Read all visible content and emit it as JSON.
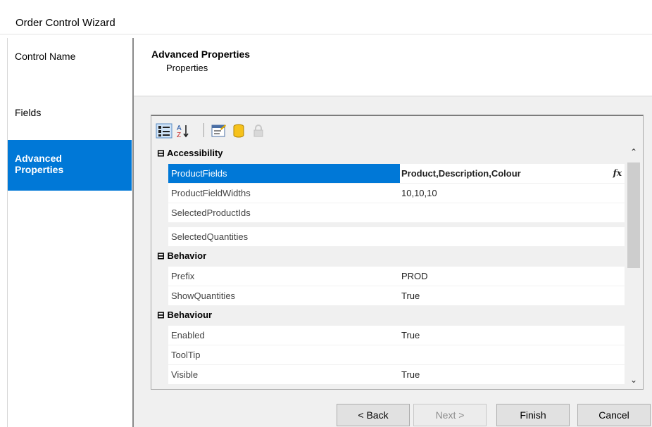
{
  "window": {
    "title": "Order Control Wizard"
  },
  "nav": {
    "items": [
      {
        "label": "Control Name"
      },
      {
        "label": "Fields"
      },
      {
        "label_line1": "Advanced",
        "label_line2": "Properties",
        "active": true
      }
    ]
  },
  "header": {
    "title": "Advanced Properties",
    "subtitle": "Properties"
  },
  "grid": {
    "toolbar_icons": [
      "categorized-icon",
      "alphabetical-icon",
      "property-pages-icon",
      "database-icon",
      "lock-icon"
    ],
    "categories": [
      {
        "name": "Accessibility",
        "properties": [
          {
            "name": "ProductFields",
            "value": "Product,Description,Colour",
            "selected": true
          },
          {
            "name": "ProductFieldWidths",
            "value": "10,10,10"
          },
          {
            "name": "SelectedProductIds",
            "value": ""
          },
          {
            "name": "SelectedQuantities",
            "value": ""
          }
        ]
      },
      {
        "name": "Behavior",
        "properties": [
          {
            "name": "Prefix",
            "value": "PROD"
          },
          {
            "name": "ShowQuantities",
            "value": "True"
          }
        ]
      },
      {
        "name": "Behaviour",
        "properties": [
          {
            "name": "Enabled",
            "value": "True"
          },
          {
            "name": "ToolTip",
            "value": ""
          },
          {
            "name": "Visible",
            "value": "True"
          }
        ]
      }
    ],
    "fx_label": "fx"
  },
  "footer": {
    "back_label": "< Back",
    "next_label": "Next >",
    "finish_label": "Finish",
    "cancel_label": "Cancel"
  },
  "colors": {
    "accent": "#0078d7"
  }
}
